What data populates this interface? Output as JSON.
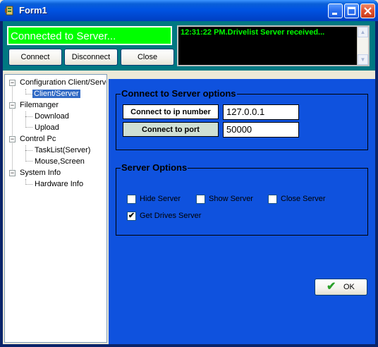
{
  "window": {
    "title": "Form1",
    "titlebar_colors": {
      "start": "#3d95ff",
      "end": "#003fc0"
    }
  },
  "top_panel": {
    "status_text": "Connected to Server...",
    "status_bg": "#00ff00",
    "buttons": {
      "connect": "Connect",
      "disconnect": "Disconnect",
      "close": "Close"
    },
    "log_text": "12:31:22 PM.Drivelist Server received...",
    "log_color": "#00ff00"
  },
  "tree": {
    "nodes": [
      {
        "label": "Configuration Client/Server",
        "expander": "-"
      },
      {
        "label": "Client/Server",
        "selected": true
      },
      {
        "label": "Filemanger",
        "expander": "-"
      },
      {
        "label": "Download"
      },
      {
        "label": "Upload"
      },
      {
        "label": "Control Pc",
        "expander": "-"
      },
      {
        "label": "TaskList(Server)"
      },
      {
        "label": "Mouse,Screen"
      },
      {
        "label": "System Info",
        "expander": "-"
      },
      {
        "label": "Hardware Info"
      }
    ]
  },
  "main": {
    "bg_color": "#0f52de",
    "connect_group": {
      "title": "Connect to Server options",
      "ip_label": "Connect to ip number",
      "ip_value": "127.0.0.1",
      "port_label": "Connect to port",
      "port_value": "50000"
    },
    "server_group": {
      "title": "Server Options",
      "options": [
        {
          "label": "Hide Server",
          "checked": false
        },
        {
          "label": "Show Server",
          "checked": false
        },
        {
          "label": "Close Server",
          "checked": false
        },
        {
          "label": "Get Drives Server",
          "checked": true
        }
      ]
    },
    "ok_label": "OK"
  },
  "icons": {
    "app": "app-icon",
    "minimize": "minimize-icon",
    "maximize": "maximize-icon",
    "close": "close-icon",
    "ok": "checkmark-icon"
  }
}
